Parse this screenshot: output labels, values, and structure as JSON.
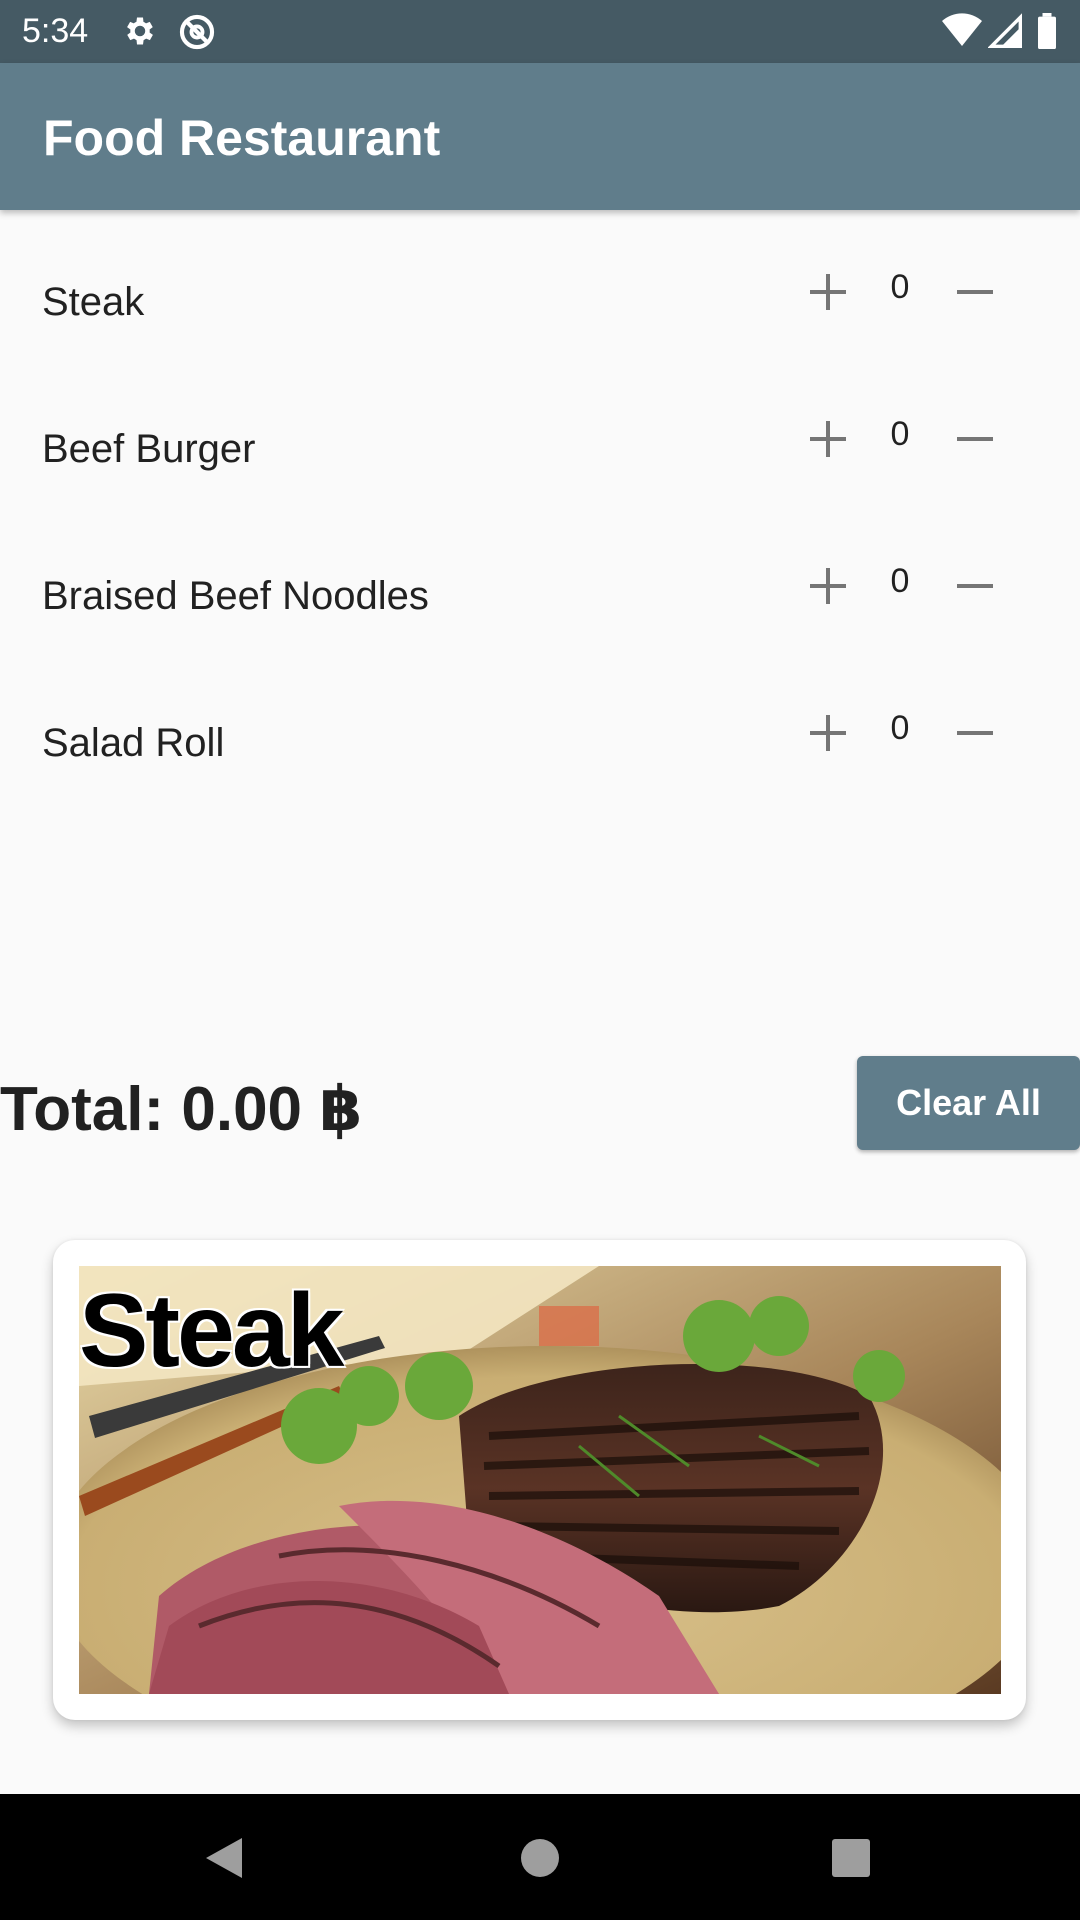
{
  "status_bar": {
    "time": "5:34",
    "icons": [
      "gear-icon",
      "at-sign-icon",
      "wifi-icon",
      "signal-icon",
      "battery-icon"
    ]
  },
  "app_bar": {
    "title": "Food Restaurant"
  },
  "menu": {
    "items": [
      {
        "name": "Steak",
        "quantity": "0"
      },
      {
        "name": "Beef Burger",
        "quantity": "0"
      },
      {
        "name": "Braised Beef Noodles",
        "quantity": "0"
      },
      {
        "name": "Salad Roll",
        "quantity": "0"
      }
    ]
  },
  "total": {
    "label": "Total: 0.00 ฿"
  },
  "clear_button": {
    "label": "Clear All"
  },
  "preview_card": {
    "caption": "Steak"
  },
  "nav_bar": {
    "icons": [
      "back-icon",
      "home-icon",
      "recents-icon"
    ]
  },
  "colors": {
    "status_bar": "#455a64",
    "app_bar": "#607d8b",
    "background": "#fafafa",
    "control_icon": "#757575"
  }
}
